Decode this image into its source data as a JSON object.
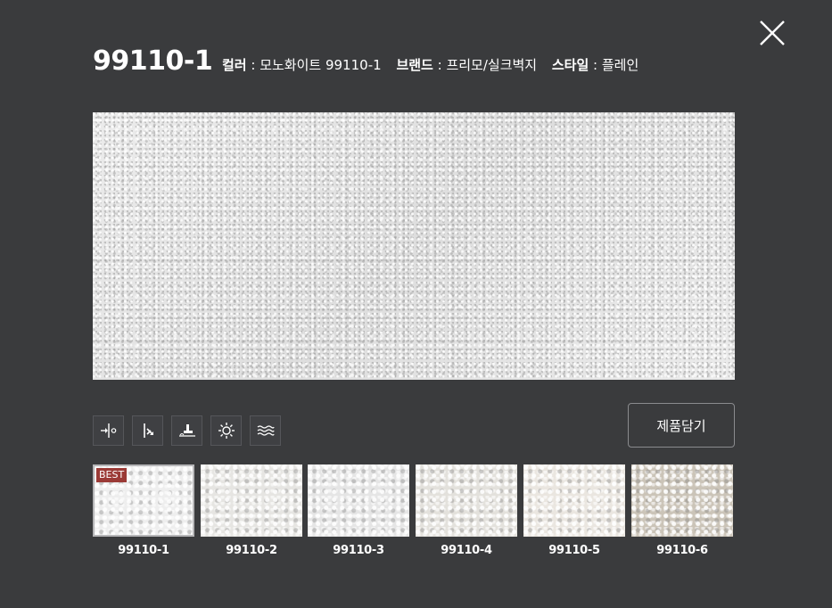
{
  "product": {
    "code": "99110-1",
    "color_key": "컬러",
    "color_value": "모노화이트 99110-1",
    "brand_key": "브랜드",
    "brand_value": "프리모/실크벽지",
    "style_key": "스타일",
    "style_value": "플레인"
  },
  "separator": " : ",
  "cart_label": "제품담기",
  "icons": [
    "repeat-pattern-icon",
    "cut-edge-icon",
    "paste-icon",
    "light-fastness-icon",
    "washable-icon"
  ],
  "thumbnails": [
    {
      "label": "99110-1",
      "badge": "BEST",
      "color": "#eeeeee",
      "active": true
    },
    {
      "label": "99110-2",
      "color": "#e6e5e2"
    },
    {
      "label": "99110-3",
      "color": "#e5e5e5"
    },
    {
      "label": "99110-4",
      "color": "#e3e1dc"
    },
    {
      "label": "99110-5",
      "color": "#eae6e0"
    },
    {
      "label": "99110-6",
      "color": "#cbc4b8"
    }
  ],
  "colors": {
    "background": "#3a3b3d",
    "badge": "#9b3a36"
  }
}
